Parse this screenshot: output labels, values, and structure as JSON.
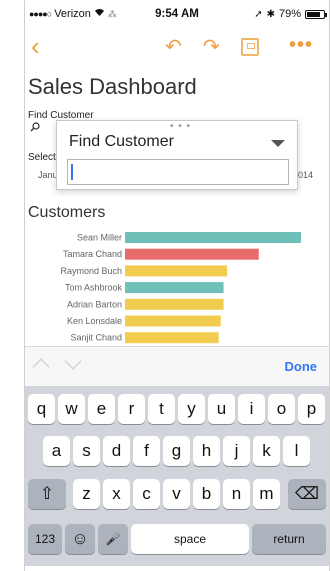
{
  "status_bar": {
    "carrier": "Verizon",
    "time": "9:54 AM",
    "battery_percent": "79%",
    "battery_level": 0.79
  },
  "toolbar": {
    "back_glyph": "‹",
    "undo_glyph": "↶",
    "redo_glyph": "↷",
    "more_glyph": "•••",
    "accent_color": "#f0a044"
  },
  "dashboard": {
    "title": "Sales Dashboard",
    "find_customer_label": "Find Customer",
    "select_label": "Select",
    "date_start_fragment": "Janu",
    "date_end_fragment": "014"
  },
  "popup": {
    "title": "Find Customer",
    "input_value": ""
  },
  "customers": {
    "title": "Customers"
  },
  "chart_data": {
    "type": "bar",
    "orientation": "horizontal",
    "categories": [
      "Sean Miller",
      "Tamara Chand",
      "Raymond Buch",
      "Tom Ashbrook",
      "Adrian Barton",
      "Ken Lonsdale",
      "Sanjit Chand"
    ],
    "values": [
      25000,
      19000,
      14500,
      14000,
      14000,
      13600,
      13300
    ],
    "colors": [
      "#6fc0b8",
      "#e96c6c",
      "#f2cc4e",
      "#6fc0b8",
      "#f2cc4e",
      "#f2cc4e",
      "#f2cc4e"
    ],
    "xlim": [
      0,
      25000
    ]
  },
  "keyboard": {
    "done_label": "Done",
    "row1": [
      "q",
      "w",
      "e",
      "r",
      "t",
      "y",
      "u",
      "i",
      "o",
      "p"
    ],
    "row2": [
      "a",
      "s",
      "d",
      "f",
      "g",
      "h",
      "j",
      "k",
      "l"
    ],
    "row3": [
      "z",
      "x",
      "c",
      "v",
      "b",
      "n",
      "m"
    ],
    "shift_glyph": "⇧",
    "delete_glyph": "⌫",
    "numbers_label": "123",
    "emoji_glyph": "☺",
    "mic_glyph": "🎤",
    "space_label": "space",
    "return_label": "return"
  }
}
